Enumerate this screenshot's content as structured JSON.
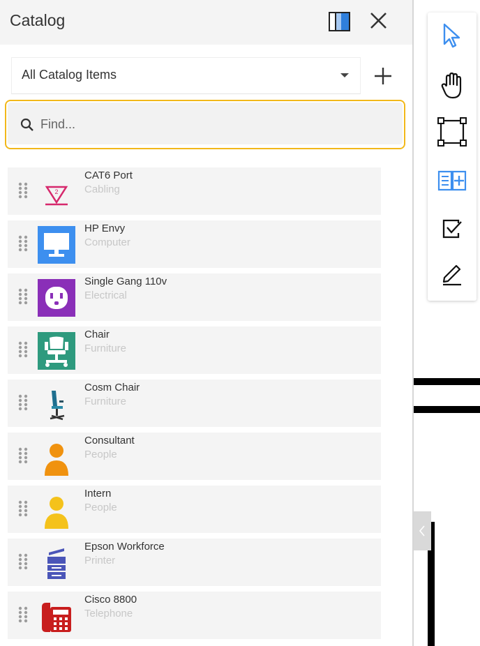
{
  "panel": {
    "title": "Catalog",
    "split_view_icon": "split-view-icon",
    "close_icon": "close-icon"
  },
  "selector": {
    "value": "All Catalog Items",
    "add_icon": "plus-icon"
  },
  "search": {
    "placeholder": "Find...",
    "value": "",
    "icon": "search-icon"
  },
  "items": [
    {
      "name": "CAT6 Port",
      "category": "Cabling",
      "icon": "cat6-port-icon"
    },
    {
      "name": "HP Envy",
      "category": "Computer",
      "icon": "monitor-icon"
    },
    {
      "name": "Single Gang 110v",
      "category": "Electrical",
      "icon": "outlet-icon"
    },
    {
      "name": "Chair",
      "category": "Furniture",
      "icon": "chair-icon"
    },
    {
      "name": "Cosm Chair",
      "category": "Furniture",
      "icon": "office-chair-icon"
    },
    {
      "name": "Consultant",
      "category": "People",
      "icon": "person-orange-icon"
    },
    {
      "name": "Intern",
      "category": "People",
      "icon": "person-yellow-icon"
    },
    {
      "name": "Epson Workforce",
      "category": "Printer",
      "icon": "printer-icon"
    },
    {
      "name": "Cisco 8800",
      "category": "Telephone",
      "icon": "telephone-icon"
    }
  ],
  "tools": [
    {
      "name": "select",
      "icon": "cursor-icon"
    },
    {
      "name": "pan",
      "icon": "hand-icon"
    },
    {
      "name": "rectangle",
      "icon": "bounding-box-icon"
    },
    {
      "name": "catalog",
      "icon": "book-add-icon"
    },
    {
      "name": "checkbox",
      "icon": "check-square-icon"
    },
    {
      "name": "edit",
      "icon": "pencil-icon"
    }
  ],
  "colors": {
    "accent": "#f2b81a",
    "tool_blue": "#3d8fef"
  }
}
